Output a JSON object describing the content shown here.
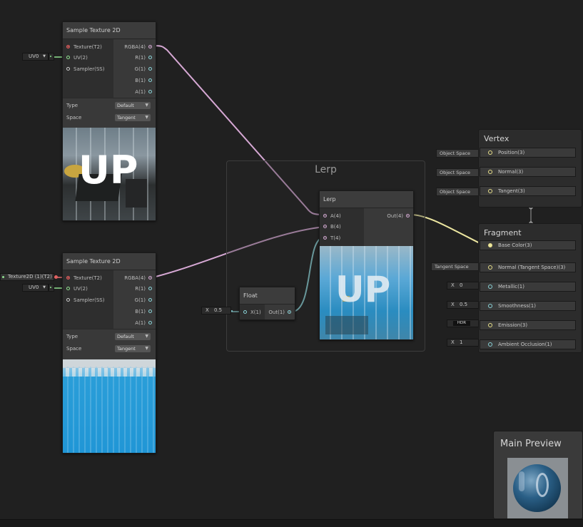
{
  "node1": {
    "title": "Sample Texture 2D",
    "inputs": [
      "Texture(T2)",
      "UV(2)",
      "Sampler(SS)"
    ],
    "outputs": [
      "RGBA(4)",
      "R(1)",
      "G(1)",
      "B(1)",
      "A(1)"
    ],
    "settings": [
      {
        "label": "Type",
        "value": "Default"
      },
      {
        "label": "Space",
        "value": "Tangent"
      }
    ],
    "uv_field": "UV0",
    "preview_text": "UP"
  },
  "node2": {
    "title": "Sample Texture 2D",
    "inputs": [
      "Texture(T2)",
      "UV(2)",
      "Sampler(SS)"
    ],
    "outputs": [
      "RGBA(4)",
      "R(1)",
      "G(1)",
      "B(1)",
      "A(1)"
    ],
    "settings": [
      {
        "label": "Type",
        "value": "Default"
      },
      {
        "label": "Space",
        "value": "Tangent"
      }
    ],
    "uv_field": "UV0",
    "texture_property": "Texture2D (1)(T2)"
  },
  "group": {
    "title": "Lerp"
  },
  "lerp": {
    "title": "Lerp",
    "inputs": [
      "A(4)",
      "B(4)",
      "T(4)"
    ],
    "output": "Out(4)",
    "preview_text": "UP"
  },
  "float_node": {
    "title": "Float",
    "input": "X(1)",
    "output": "Out(1)",
    "field_axis": "X",
    "field_value": "0.5"
  },
  "vertex": {
    "title": "Vertex",
    "blocks": [
      {
        "label": "Position(3)",
        "space": "Object Space"
      },
      {
        "label": "Normal(3)",
        "space": "Object Space"
      },
      {
        "label": "Tangent(3)",
        "space": "Object Space"
      }
    ]
  },
  "fragment": {
    "title": "Fragment",
    "blocks": [
      {
        "label": "Base Color(3)",
        "field": ""
      },
      {
        "label": "Normal (Tangent Space)(3)",
        "field": "Tangent Space"
      },
      {
        "label": "Metallic(1)",
        "axis": "X",
        "field": "0"
      },
      {
        "label": "Smoothness(1)",
        "axis": "X",
        "field": "0.5"
      },
      {
        "label": "Emission(3)",
        "field": "HDR"
      },
      {
        "label": "Ambient Occlusion(1)",
        "axis": "X",
        "field": "1"
      }
    ]
  },
  "main_preview": {
    "title": "Main Preview"
  },
  "colors": {
    "edge_vector4": "#d6a8d4",
    "edge_vector1": "#8ad3d8",
    "edge_vector3": "#ece6a0",
    "edge_uv": "#90e090",
    "port_texture": "#e06060"
  }
}
